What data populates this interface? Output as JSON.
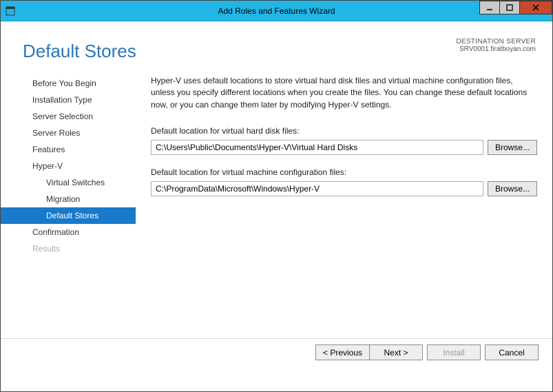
{
  "window": {
    "title": "Add Roles and Features Wizard"
  },
  "destination": {
    "heading": "DESTINATION SERVER",
    "name": "SRV0001.firatboyan.com"
  },
  "page": {
    "title": "Default Stores",
    "description": "Hyper-V uses default locations to store virtual hard disk files and virtual machine configuration files, unless you specify different locations when you create the files. You can change these default locations now, or you can change them later by modifying Hyper-V settings."
  },
  "nav": {
    "items": [
      {
        "label": "Before You Begin",
        "selected": false,
        "sub": false,
        "disabled": false
      },
      {
        "label": "Installation Type",
        "selected": false,
        "sub": false,
        "disabled": false
      },
      {
        "label": "Server Selection",
        "selected": false,
        "sub": false,
        "disabled": false
      },
      {
        "label": "Server Roles",
        "selected": false,
        "sub": false,
        "disabled": false
      },
      {
        "label": "Features",
        "selected": false,
        "sub": false,
        "disabled": false
      },
      {
        "label": "Hyper-V",
        "selected": false,
        "sub": false,
        "disabled": false
      },
      {
        "label": "Virtual Switches",
        "selected": false,
        "sub": true,
        "disabled": false
      },
      {
        "label": "Migration",
        "selected": false,
        "sub": true,
        "disabled": false
      },
      {
        "label": "Default Stores",
        "selected": true,
        "sub": true,
        "disabled": false
      },
      {
        "label": "Confirmation",
        "selected": false,
        "sub": false,
        "disabled": false
      },
      {
        "label": "Results",
        "selected": false,
        "sub": false,
        "disabled": true
      }
    ]
  },
  "fields": {
    "vhd": {
      "label": "Default location for virtual hard disk files:",
      "value": "C:\\Users\\Public\\Documents\\Hyper-V\\Virtual Hard Disks",
      "browse": "Browse..."
    },
    "vmconfig": {
      "label": "Default location for virtual machine configuration files:",
      "value": "C:\\ProgramData\\Microsoft\\Windows\\Hyper-V",
      "browse": "Browse..."
    }
  },
  "footer": {
    "previous": "< Previous",
    "next": "Next >",
    "install": "Install",
    "cancel": "Cancel"
  }
}
